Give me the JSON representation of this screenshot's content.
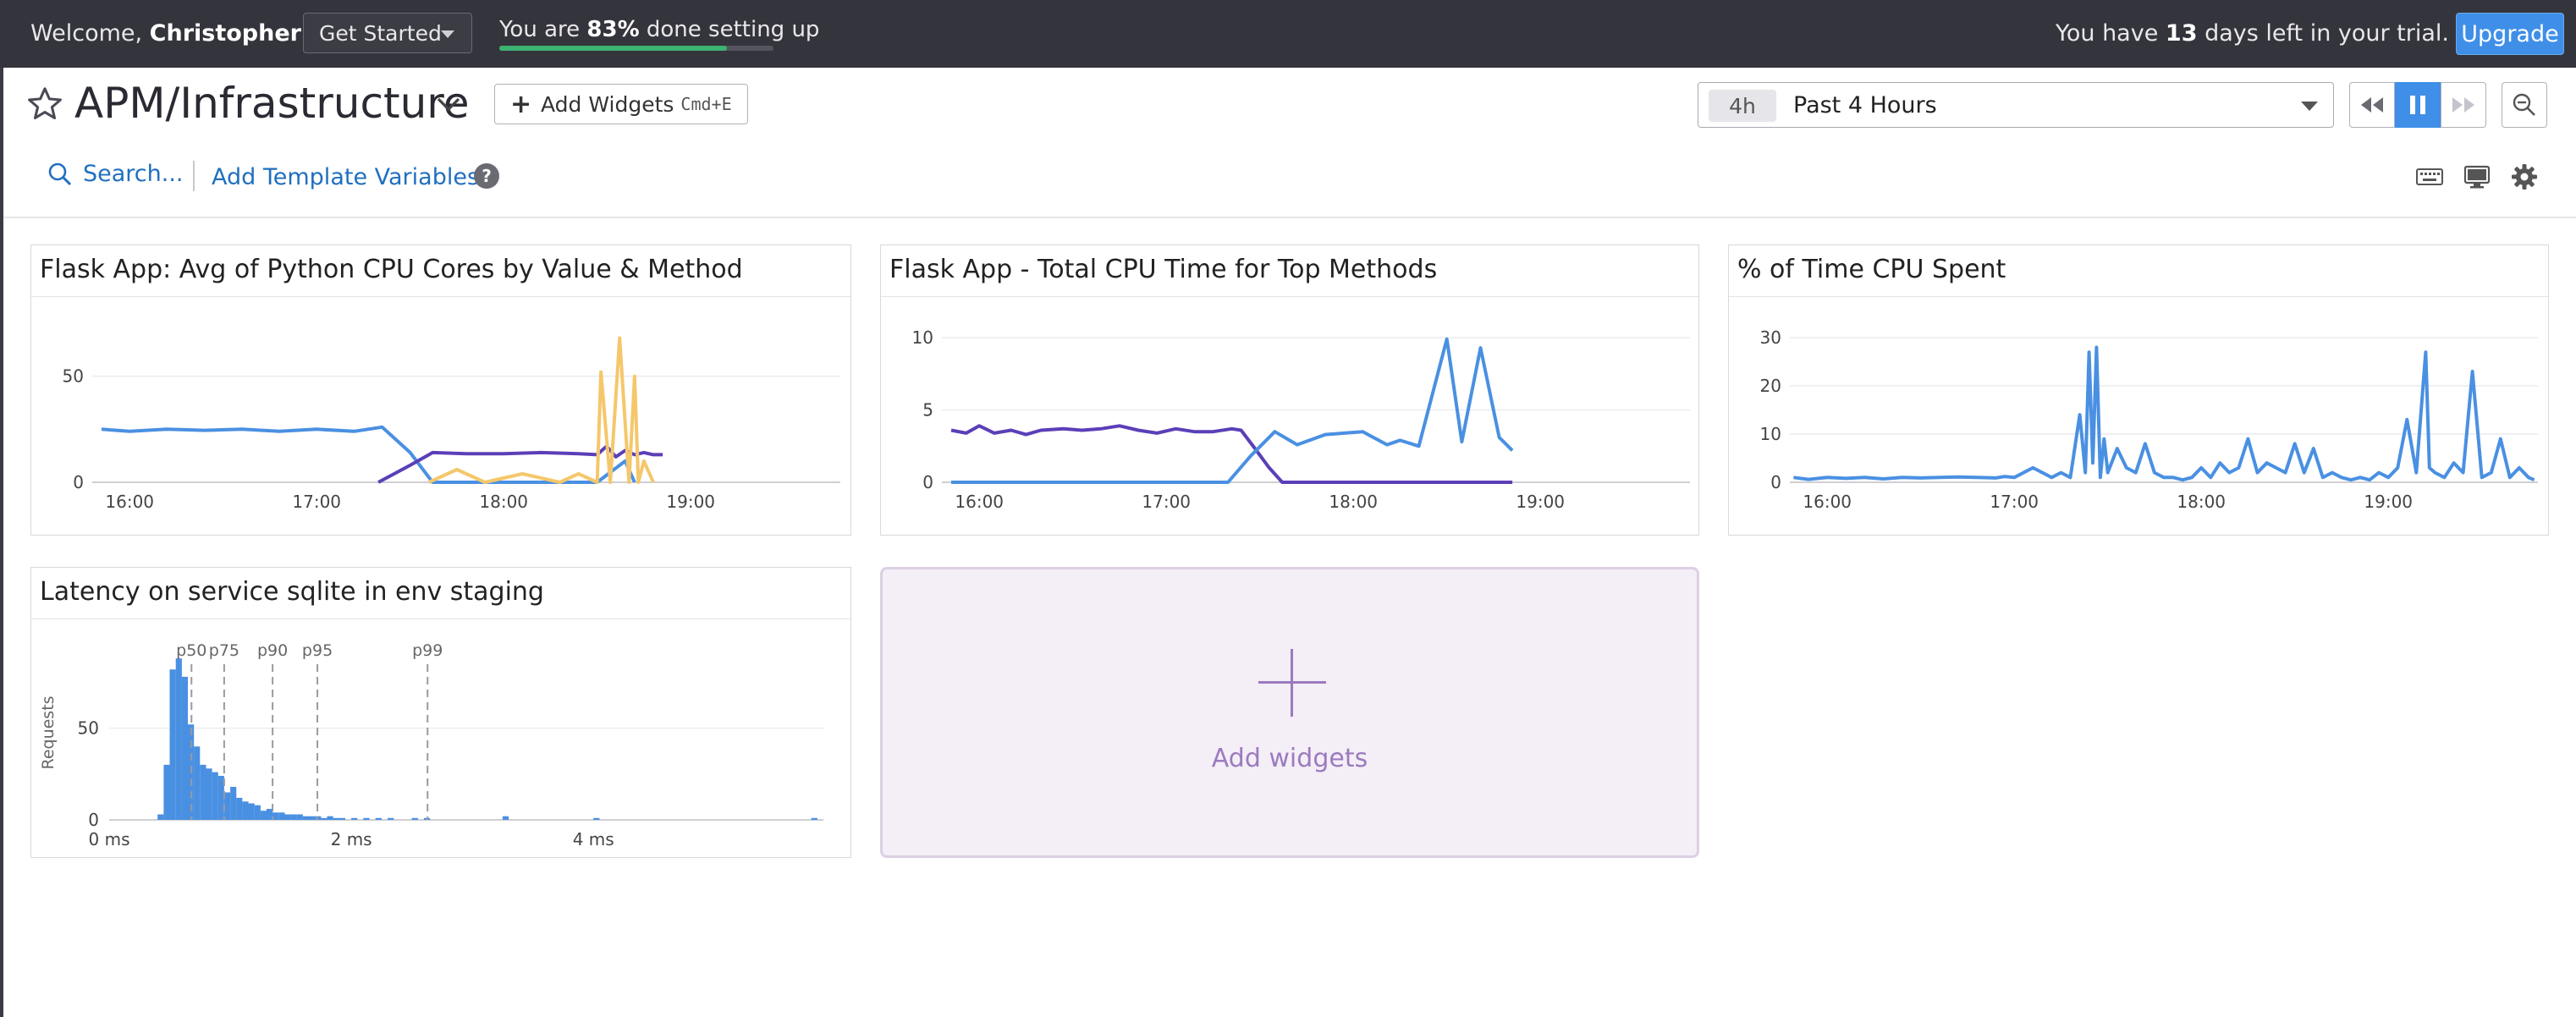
{
  "topbar": {
    "welcome_prefix": "Welcome, ",
    "user_name": "Christopher",
    "welcome_suffix": "!",
    "get_started_label": "Get Started",
    "setup_prefix": "You are ",
    "setup_percent_text": "83%",
    "setup_suffix": " done setting up",
    "setup_progress": 0.83,
    "trial_prefix": "You have ",
    "trial_days": "13",
    "trial_suffix": " days left in your trial.",
    "upgrade_label": "Upgrade"
  },
  "header": {
    "dashboard_title": "APM/Infrastructure",
    "add_widgets_label": "Add Widgets",
    "add_widgets_shortcut": "Cmd+E",
    "search_label": "Search...",
    "template_variables_label": "Add Template Variables",
    "help_glyph": "?"
  },
  "timepicker": {
    "badge": "4h",
    "label": "Past 4 Hours"
  },
  "icons": {
    "favorite": "star-icon",
    "title_dropdown": "chevron-down-icon",
    "rewind": "rewind-icon",
    "pause": "pause-icon",
    "forward": "fast-forward-icon",
    "zoom_out": "zoom-out-icon",
    "search": "search-icon",
    "help": "help-circle-icon",
    "keyboard": "keyboard-icon",
    "tv_mode": "monitor-icon",
    "settings": "gear-icon"
  },
  "colors": {
    "accent": "#3f8fe8",
    "series_blue": "#4a90e2",
    "series_purple": "#5b3fb8",
    "series_gold": "#f5c76b",
    "histogram": "#4a90e2",
    "add_widget": "#9b7bbf"
  },
  "widgets": {
    "w1": {
      "title": "Flask App: Avg of Python CPU Cores by Value & Method"
    },
    "w2": {
      "title": "Flask App - Total CPU Time for Top Methods"
    },
    "w3": {
      "title": "% of Time CPU Spent"
    },
    "w4": {
      "title": "Latency on service sqlite in env staging"
    },
    "add_widgets_tile": {
      "label": "Add widgets"
    }
  },
  "chart_data": [
    {
      "type": "line",
      "title": "Flask App: Avg of Python CPU Cores by Value & Method",
      "x_ticks": [
        "16:00",
        "17:00",
        "18:00",
        "19:00"
      ],
      "x_tick_values": [
        16.0,
        17.0,
        18.0,
        19.0
      ],
      "xlim": [
        15.8,
        19.8
      ],
      "y_ticks": [
        0,
        50
      ],
      "ylim": [
        0,
        75
      ],
      "series": [
        {
          "color": "#4a90e2",
          "x": [
            15.85,
            16.0,
            16.2,
            16.4,
            16.6,
            16.8,
            17.0,
            17.2,
            17.35,
            17.5,
            17.62,
            17.7,
            17.9,
            18.1,
            18.3,
            18.5,
            18.65,
            18.7
          ],
          "values": [
            25,
            24,
            25,
            24.5,
            25,
            24,
            25,
            24,
            26,
            14,
            0,
            0,
            0,
            0,
            0,
            0,
            10,
            0
          ]
        },
        {
          "color": "#5b3fb8",
          "x": [
            17.33,
            17.5,
            17.62,
            17.8,
            18.0,
            18.2,
            18.4,
            18.5,
            18.55,
            18.6,
            18.65,
            18.7,
            18.75,
            18.8,
            18.85
          ],
          "values": [
            0,
            8,
            14,
            13.5,
            13.5,
            14,
            13.5,
            13,
            17,
            12,
            15,
            13,
            14,
            13,
            13
          ]
        },
        {
          "color": "#f5c76b",
          "x": [
            17.6,
            17.75,
            17.9,
            18.1,
            18.3,
            18.4,
            18.5,
            18.52,
            18.57,
            18.62,
            18.67,
            18.7,
            18.72,
            18.75,
            18.8
          ],
          "values": [
            0,
            6,
            0,
            4,
            0,
            4,
            0,
            52,
            0,
            68,
            0,
            50,
            0,
            10,
            0
          ]
        }
      ]
    },
    {
      "type": "line",
      "title": "Flask App - Total CPU Time for Top Methods",
      "x_ticks": [
        "16:00",
        "17:00",
        "18:00",
        "19:00"
      ],
      "x_tick_values": [
        16.0,
        17.0,
        18.0,
        19.0
      ],
      "xlim": [
        15.8,
        19.8
      ],
      "y_ticks": [
        0,
        5,
        10
      ],
      "ylim": [
        0,
        11
      ],
      "series": [
        {
          "color": "#5b3fb8",
          "x": [
            15.85,
            15.93,
            16.0,
            16.08,
            16.17,
            16.25,
            16.33,
            16.45,
            16.55,
            16.65,
            16.75,
            16.85,
            16.95,
            17.05,
            17.15,
            17.25,
            17.35,
            17.4,
            17.47,
            17.55,
            17.62,
            17.8,
            18.0,
            18.3,
            18.6,
            18.85
          ],
          "values": [
            3.6,
            3.4,
            3.9,
            3.4,
            3.6,
            3.3,
            3.6,
            3.7,
            3.6,
            3.7,
            3.9,
            3.6,
            3.4,
            3.7,
            3.5,
            3.5,
            3.7,
            3.6,
            2.4,
            1.0,
            0,
            0,
            0,
            0,
            0,
            0
          ]
        },
        {
          "color": "#4a90e2",
          "x": [
            15.85,
            16.5,
            17.0,
            17.33,
            17.45,
            17.58,
            17.7,
            17.85,
            18.05,
            18.18,
            18.25,
            18.35,
            18.5,
            18.58,
            18.68,
            18.78,
            18.85
          ],
          "values": [
            0,
            0,
            0,
            0,
            1.8,
            3.5,
            2.6,
            3.3,
            3.5,
            2.6,
            2.9,
            2.5,
            9.9,
            2.8,
            9.3,
            3.1,
            2.2
          ]
        }
      ]
    },
    {
      "type": "line",
      "title": "% of Time CPU Spent",
      "x_ticks": [
        "16:00",
        "17:00",
        "18:00",
        "19:00"
      ],
      "x_tick_values": [
        16.0,
        17.0,
        18.0,
        19.0
      ],
      "xlim": [
        15.8,
        19.8
      ],
      "y_ticks": [
        0,
        10,
        20,
        30
      ],
      "ylim": [
        0,
        33
      ],
      "series": [
        {
          "color": "#4a90e2",
          "x": [
            15.82,
            15.9,
            16.0,
            16.1,
            16.2,
            16.3,
            16.4,
            16.5,
            16.6,
            16.7,
            16.8,
            16.9,
            16.95,
            17.0,
            17.1,
            17.2,
            17.25,
            17.3,
            17.35,
            17.38,
            17.4,
            17.42,
            17.44,
            17.46,
            17.48,
            17.5,
            17.55,
            17.6,
            17.65,
            17.7,
            17.75,
            17.8,
            17.85,
            17.9,
            17.95,
            18.0,
            18.05,
            18.1,
            18.15,
            18.2,
            18.25,
            18.3,
            18.35,
            18.4,
            18.45,
            18.5,
            18.55,
            18.6,
            18.65,
            18.7,
            18.75,
            18.8,
            18.85,
            18.9,
            18.95,
            19.0,
            19.05,
            19.1,
            19.15,
            19.2,
            19.22,
            19.25,
            19.3,
            19.35,
            19.4,
            19.45,
            19.5,
            19.55,
            19.6,
            19.65,
            19.7,
            19.75,
            19.78
          ],
          "values": [
            1,
            0.6,
            1,
            0.8,
            1,
            0.7,
            1,
            0.9,
            1,
            1.1,
            1,
            0.9,
            1.2,
            1,
            3,
            1,
            2,
            1,
            14,
            2,
            27,
            4,
            28,
            1,
            9,
            2,
            7,
            3,
            2,
            8,
            2,
            1,
            1,
            0.5,
            1,
            3,
            1,
            4,
            2,
            3,
            9,
            2,
            4,
            3,
            2,
            8,
            2,
            7,
            1,
            2,
            1,
            0.5,
            1,
            0.5,
            2,
            1,
            3,
            13,
            2,
            27,
            3,
            2,
            1,
            4,
            2,
            23,
            1,
            2,
            9,
            1,
            3,
            1,
            0.5
          ]
        }
      ]
    },
    {
      "type": "bar",
      "title": "Latency on service sqlite in env staging",
      "ylabel": "Requests",
      "x_ticks": [
        "0 ms",
        "2 ms",
        "4 ms"
      ],
      "x_tick_values": [
        0,
        2,
        4
      ],
      "xlim": [
        0,
        5.9
      ],
      "y_ticks": [
        0,
        50
      ],
      "ylim": [
        0,
        95
      ],
      "bin_width": 0.05,
      "bins_x": [
        0.4,
        0.45,
        0.5,
        0.55,
        0.6,
        0.65,
        0.7,
        0.75,
        0.8,
        0.85,
        0.9,
        0.95,
        1.0,
        1.05,
        1.1,
        1.15,
        1.2,
        1.25,
        1.3,
        1.35,
        1.4,
        1.45,
        1.5,
        1.55,
        1.6,
        1.65,
        1.7,
        1.75,
        1.8,
        1.85,
        1.9,
        2.0,
        2.1,
        2.2,
        2.3,
        2.5,
        2.6,
        3.25,
        4.0,
        5.8
      ],
      "values": [
        3,
        30,
        82,
        88,
        78,
        52,
        40,
        30,
        28,
        26,
        24,
        15,
        18,
        12,
        10,
        9,
        8,
        5,
        6,
        4,
        4,
        3,
        3,
        3,
        2,
        2,
        2,
        1,
        2,
        1,
        1,
        1,
        1,
        1,
        1,
        1,
        1,
        2,
        1,
        1
      ],
      "markers": [
        {
          "label": "p50",
          "x": 0.68
        },
        {
          "label": "p75",
          "x": 0.95
        },
        {
          "label": "p90",
          "x": 1.35
        },
        {
          "label": "p95",
          "x": 1.72
        },
        {
          "label": "p99",
          "x": 2.63
        }
      ]
    }
  ]
}
